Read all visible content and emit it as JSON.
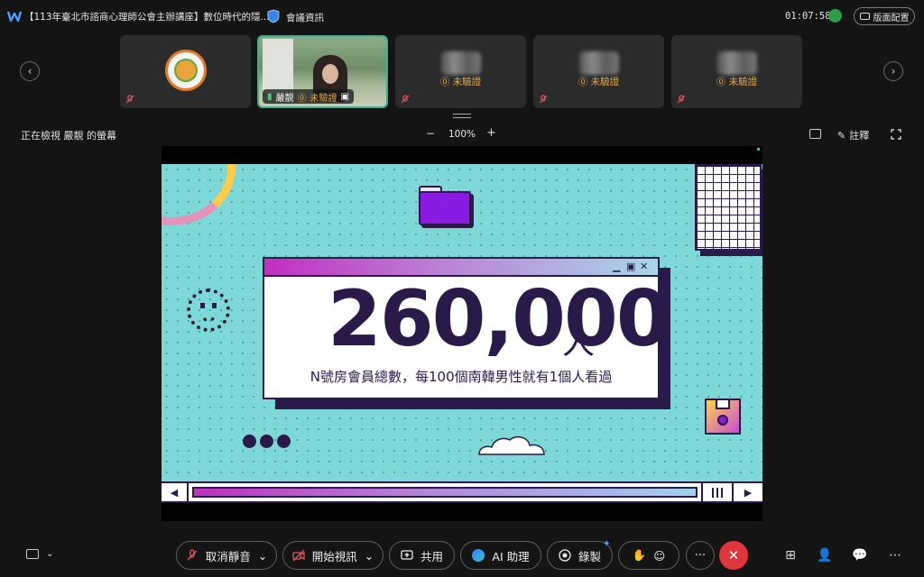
{
  "titlebar": {
    "meeting_title": "【113年臺北市諮商心理師公會主辦講座】數位時代的隱...",
    "meeting_info": "會議資訊",
    "clock": "01:07:58",
    "layout_label": "版面配置"
  },
  "participants": [
    {
      "type": "logo",
      "muted": true
    },
    {
      "type": "video",
      "name": "嚴靚",
      "status": "未驗證",
      "active": true
    },
    {
      "type": "blurred",
      "status": "未驗證"
    },
    {
      "type": "blurred",
      "status": "未驗證"
    },
    {
      "type": "blurred",
      "status": "未驗證"
    }
  ],
  "share_toolbar": {
    "viewing_label": "正在檢視 嚴靚 的螢幕",
    "zoom_minus": "−",
    "zoom_level": "100%",
    "zoom_plus": "+",
    "annotate_label": "註釋"
  },
  "slide": {
    "big_number": "260,000",
    "unit": "人",
    "caption": "N號房會員總數，每100個南韓男性就有1個人看過"
  },
  "controls": {
    "unmute": "取消靜音",
    "start_video": "開始視訊",
    "share": "共用",
    "ai_assistant": "AI 助理",
    "record": "錄製",
    "more": "···"
  },
  "colors": {
    "slide_bg": "#7fd8d8",
    "ink": "#2a1a4a",
    "hangup": "#e0353b",
    "warning": "#e9a84a",
    "active_border": "#3fae8a"
  }
}
